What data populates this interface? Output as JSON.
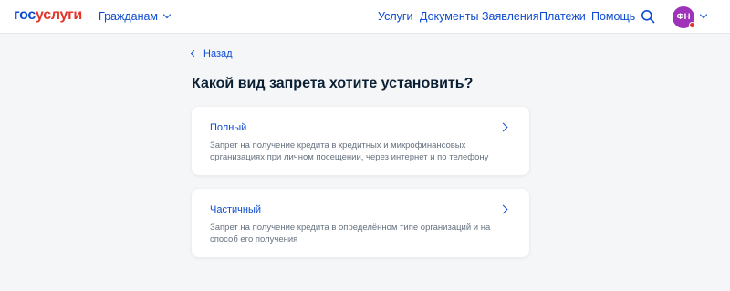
{
  "header": {
    "logo_part1": "гос",
    "logo_part2": "услуги",
    "audience": "Гражданам",
    "nav": [
      "Услуги",
      "Документы",
      "Заявления",
      "Платежи",
      "Помощь"
    ],
    "search_icon": "search-icon",
    "avatar_initials": "ФН"
  },
  "colors": {
    "brand_blue": "#0d4cd3",
    "brand_red": "#e3352b",
    "avatar": "#9e32b8",
    "background": "#f5f6f8"
  },
  "main": {
    "back_label": "Назад",
    "title": "Какой вид запрета хотите установить?",
    "options": [
      {
        "title": "Полный",
        "description": "Запрет на получение кредита в кредитных и микрофинансовых организациях при личном посещении, через интернет и по телефону"
      },
      {
        "title": "Частичный",
        "description": "Запрет на получение кредита в определённом типе организаций и на способ его получения"
      }
    ]
  }
}
